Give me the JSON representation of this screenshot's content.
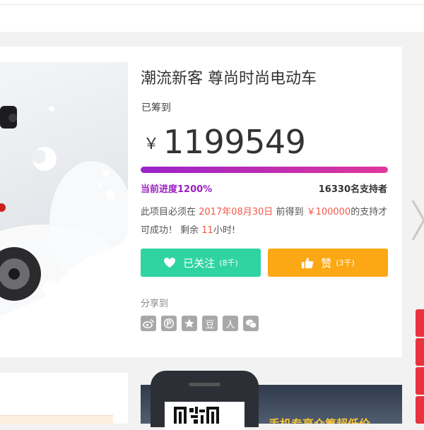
{
  "project": {
    "title": "潮流新客 尊尚时尚电动车",
    "raised_label": "已筹到",
    "currency_symbol": "￥",
    "raised_amount": "1199549",
    "progress_text": "当前进度1200%",
    "progress_percent": 1200,
    "supporters_text": "16330名支持者",
    "description": {
      "part1": "此项目必须在 ",
      "deadline": "2017年08月30日",
      "part2": " 前得到 ",
      "target": "￥100000",
      "part3": "的支持才可成功！ 剩余 ",
      "hours": "11",
      "part4": "小时!"
    }
  },
  "actions": {
    "follow_label": "已关注",
    "follow_count": "(8千)",
    "like_label": "赞",
    "like_count": "(3千)"
  },
  "share": {
    "label": "分享到",
    "icons": [
      "weibo-icon",
      "pengyou-icon",
      "qzone-icon",
      "douban-icon",
      "renren-icon",
      "wechat-icon"
    ],
    "douban_glyph": "豆",
    "renren_glyph": "人"
  },
  "banner": {
    "text": "手机专享众筹超低价"
  },
  "colors": {
    "follow_button": "#2fd4a0",
    "like_button": "#fca814",
    "progress_start": "#9a23c9",
    "progress_end": "#e0379c",
    "highlight": "#f15a4a",
    "side_tab": "#e8333e"
  }
}
